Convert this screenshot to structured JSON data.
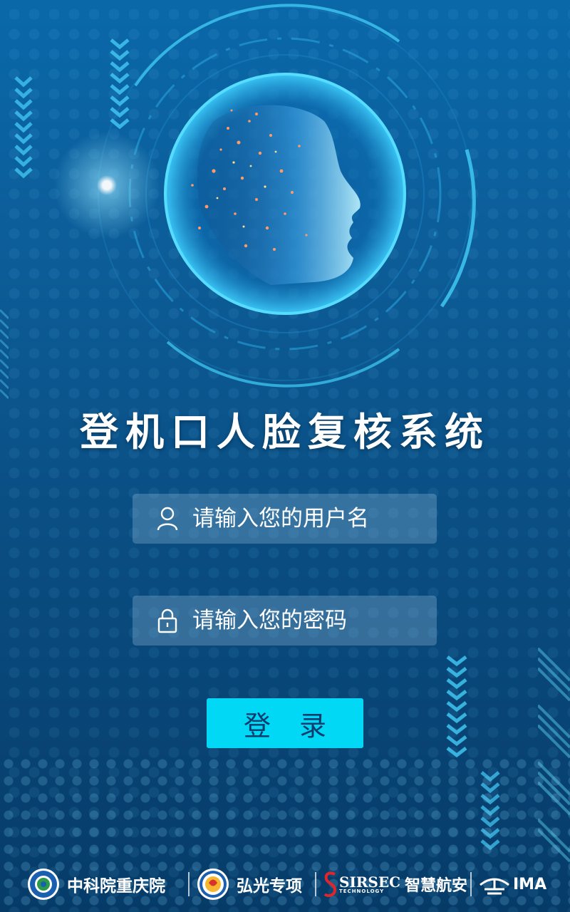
{
  "title": "登机口人脸复核系统",
  "form": {
    "username_placeholder": "请输入您的用户名",
    "password_placeholder": "请输入您的密码",
    "login_label": "登 录"
  },
  "footer": {
    "brands": [
      {
        "label": "中科院重庆院",
        "icon": "cas-chongqing-logo"
      },
      {
        "label": "弘光专项",
        "icon": "hongguang-logo"
      },
      {
        "label": "SIRSEC",
        "sub": "TECHNOLOGY",
        "tail": "智慧航安",
        "icon": "sirsec-logo"
      },
      {
        "label": "IMA",
        "icon": "ima-logo"
      }
    ]
  },
  "colors": {
    "accent": "#00d8f5",
    "background_top": "#0a68a9",
    "background_bottom": "#063b68",
    "sirsec_red": "#e2252b"
  }
}
